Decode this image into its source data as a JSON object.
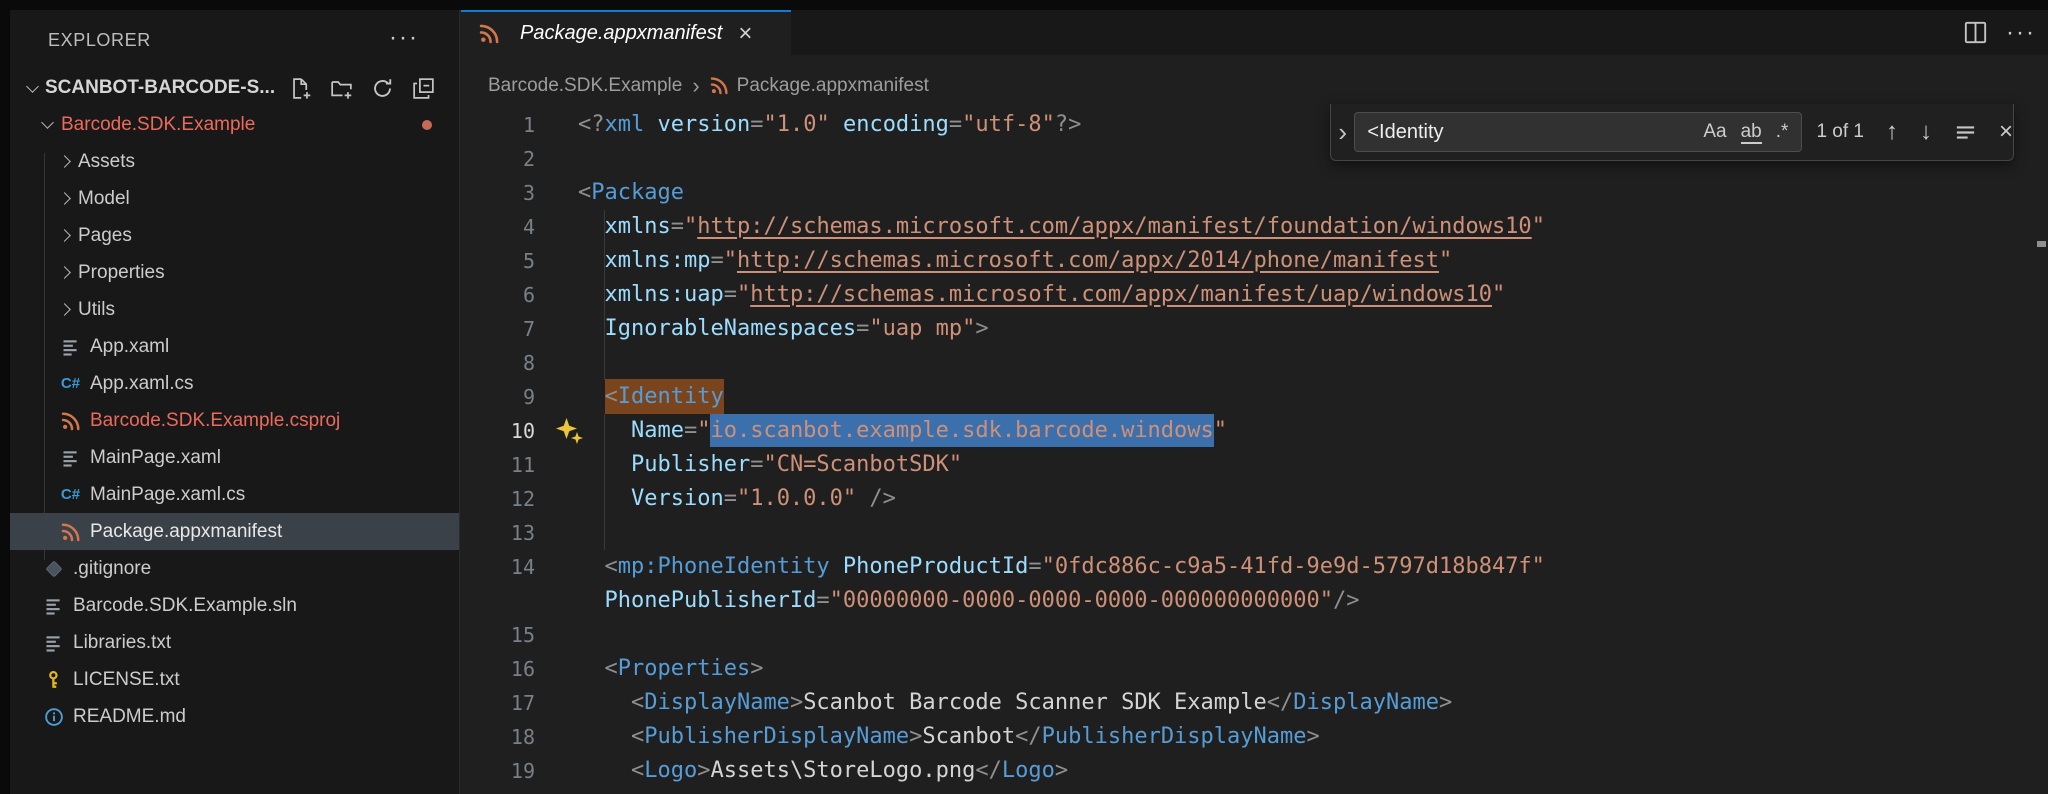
{
  "colors": {
    "accent_blue": "#0f7cd6",
    "modified_red": "#ec6a5c",
    "selection_blue": "#3b70ad",
    "find_match_brown": "#7a441c",
    "editor_bg": "#1f1f1f",
    "sidebar_bg": "#181818"
  },
  "sidebar": {
    "title": "EXPLORER",
    "more_label": "···",
    "workspace": {
      "label": "SCANBOT-BARCODE-S..."
    },
    "tree": [
      {
        "label": "Barcode.SDK.Example",
        "type": "folder",
        "expanded": true,
        "level": 1,
        "modified": true,
        "dot": true
      },
      {
        "label": "Assets",
        "type": "folder",
        "level": 2
      },
      {
        "label": "Model",
        "type": "folder",
        "level": 2
      },
      {
        "label": "Pages",
        "type": "folder",
        "level": 2
      },
      {
        "label": "Properties",
        "type": "folder",
        "level": 2
      },
      {
        "label": "Utils",
        "type": "folder",
        "level": 2
      },
      {
        "label": "App.xaml",
        "icon": "lines",
        "level": 2
      },
      {
        "label": "App.xaml.cs",
        "icon": "csharp",
        "level": 2
      },
      {
        "label": "Barcode.SDK.Example.csproj",
        "icon": "rss",
        "level": 2,
        "modified": true
      },
      {
        "label": "MainPage.xaml",
        "icon": "lines",
        "level": 2
      },
      {
        "label": "MainPage.xaml.cs",
        "icon": "csharp",
        "level": 2
      },
      {
        "label": "Package.appxmanifest",
        "icon": "rss",
        "level": 2,
        "selected": true
      },
      {
        "label": ".gitignore",
        "icon": "git",
        "level": 1
      },
      {
        "label": "Barcode.SDK.Example.sln",
        "icon": "lines",
        "level": 1
      },
      {
        "label": "Libraries.txt",
        "icon": "lines",
        "level": 1
      },
      {
        "label": "LICENSE.txt",
        "icon": "key",
        "level": 1
      },
      {
        "label": "README.md",
        "icon": "info",
        "level": 1
      }
    ]
  },
  "editor": {
    "tab": {
      "label": "Package.appxmanifest",
      "icon": "rss",
      "close": "×"
    },
    "breadcrumb": {
      "items": [
        "Barcode.SDK.Example",
        "Package.appxmanifest"
      ],
      "separator": "›"
    },
    "find": {
      "query": "<Identity",
      "match_case": "Aa",
      "whole_word": "ab",
      "regex": ".*",
      "results": "1 of 1",
      "prev": "↑",
      "next": "↓",
      "close": "×",
      "expand": "›"
    },
    "code": {
      "lines": [
        {
          "n": "1",
          "segs": [
            [
              "p",
              "<?"
            ],
            [
              "tag",
              "xml"
            ],
            [
              "d",
              " "
            ],
            [
              "attr",
              "version"
            ],
            [
              "p",
              "="
            ],
            [
              "str",
              "\"1.0\""
            ],
            [
              "d",
              " "
            ],
            [
              "attr",
              "encoding"
            ],
            [
              "p",
              "="
            ],
            [
              "str",
              "\"utf-8\""
            ],
            [
              "p",
              "?>"
            ]
          ]
        },
        {
          "n": "2",
          "segs": []
        },
        {
          "n": "3",
          "segs": [
            [
              "p",
              "<"
            ],
            [
              "tag",
              "Package"
            ]
          ]
        },
        {
          "n": "4",
          "g": true,
          "segs": [
            [
              "d",
              "  "
            ],
            [
              "attr",
              "xmlns"
            ],
            [
              "p",
              "="
            ],
            [
              "str",
              "\""
            ],
            [
              "url",
              "http://schemas.microsoft.com/appx/manifest/foundation/windows10"
            ],
            [
              "str",
              "\""
            ]
          ]
        },
        {
          "n": "5",
          "g": true,
          "segs": [
            [
              "d",
              "  "
            ],
            [
              "attr",
              "xmlns:mp"
            ],
            [
              "p",
              "="
            ],
            [
              "str",
              "\""
            ],
            [
              "url",
              "http://schemas.microsoft.com/appx/2014/phone/manifest"
            ],
            [
              "str",
              "\""
            ]
          ]
        },
        {
          "n": "6",
          "g": true,
          "segs": [
            [
              "d",
              "  "
            ],
            [
              "attr",
              "xmlns:uap"
            ],
            [
              "p",
              "="
            ],
            [
              "str",
              "\""
            ],
            [
              "url",
              "http://schemas.microsoft.com/appx/manifest/uap/windows10"
            ],
            [
              "str",
              "\""
            ]
          ]
        },
        {
          "n": "7",
          "g": true,
          "segs": [
            [
              "d",
              "  "
            ],
            [
              "attr",
              "IgnorableNamespaces"
            ],
            [
              "p",
              "="
            ],
            [
              "str",
              "\"uap mp\""
            ],
            [
              "p",
              ">"
            ]
          ]
        },
        {
          "n": "8",
          "g": true,
          "segs": []
        },
        {
          "n": "9",
          "segs": [
            [
              "d",
              "  "
            ],
            [
              "p hl",
              "<"
            ],
            [
              "tag hl",
              "Identity"
            ]
          ]
        },
        {
          "n": "10",
          "active": true,
          "spark": true,
          "g": true,
          "segs": [
            [
              "d",
              "    "
            ],
            [
              "attr",
              "Name"
            ],
            [
              "p",
              "="
            ],
            [
              "str",
              "\""
            ],
            [
              "str sel",
              "io.scanbot.example.sdk.barcode.windows"
            ],
            [
              "str",
              "\""
            ]
          ]
        },
        {
          "n": "11",
          "g": true,
          "segs": [
            [
              "d",
              "    "
            ],
            [
              "attr",
              "Publisher"
            ],
            [
              "p",
              "="
            ],
            [
              "str",
              "\"CN=ScanbotSDK\""
            ]
          ]
        },
        {
          "n": "12",
          "g": true,
          "segs": [
            [
              "d",
              "    "
            ],
            [
              "attr",
              "Version"
            ],
            [
              "p",
              "="
            ],
            [
              "str",
              "\"1.0.0.0\""
            ],
            [
              "d",
              " "
            ],
            [
              "p",
              "/>"
            ]
          ]
        },
        {
          "n": "13",
          "g": true,
          "segs": []
        },
        {
          "n": "14",
          "segs": [
            [
              "d",
              "  "
            ],
            [
              "p",
              "<"
            ],
            [
              "tag",
              "mp:PhoneIdentity"
            ],
            [
              "d",
              " "
            ],
            [
              "attr",
              "PhoneProductId"
            ],
            [
              "p",
              "="
            ],
            [
              "str",
              "\"0fdc886c-c9a5-41fd-9e9d-5797d18b847f\""
            ]
          ]
        },
        {
          "n": "",
          "segs": [
            [
              "d",
              "  "
            ],
            [
              "attr",
              "PhonePublisherId"
            ],
            [
              "p",
              "="
            ],
            [
              "str",
              "\"00000000-0000-0000-0000-000000000000\""
            ],
            [
              "p",
              "/>"
            ]
          ]
        },
        {
          "n": "15",
          "segs": []
        },
        {
          "n": "16",
          "segs": [
            [
              "d",
              "  "
            ],
            [
              "p",
              "<"
            ],
            [
              "tag",
              "Properties"
            ],
            [
              "p",
              ">"
            ]
          ]
        },
        {
          "n": "17",
          "segs": [
            [
              "d",
              "    "
            ],
            [
              "p",
              "<"
            ],
            [
              "tag",
              "DisplayName"
            ],
            [
              "p",
              ">"
            ],
            [
              "txt",
              "Scanbot Barcode Scanner SDK Example"
            ],
            [
              "p",
              "</"
            ],
            [
              "tag",
              "DisplayName"
            ],
            [
              "p",
              ">"
            ]
          ]
        },
        {
          "n": "18",
          "segs": [
            [
              "d",
              "    "
            ],
            [
              "p",
              "<"
            ],
            [
              "tag",
              "PublisherDisplayName"
            ],
            [
              "p",
              ">"
            ],
            [
              "txt",
              "Scanbot"
            ],
            [
              "p",
              "</"
            ],
            [
              "tag",
              "PublisherDisplayName"
            ],
            [
              "p",
              ">"
            ]
          ]
        },
        {
          "n": "19",
          "segs": [
            [
              "d",
              "    "
            ],
            [
              "p",
              "<"
            ],
            [
              "tag",
              "Logo"
            ],
            [
              "p",
              ">"
            ],
            [
              "txt",
              "Assets\\StoreLogo.png"
            ],
            [
              "p",
              "</"
            ],
            [
              "tag",
              "Logo"
            ],
            [
              "p",
              ">"
            ]
          ]
        }
      ]
    }
  }
}
